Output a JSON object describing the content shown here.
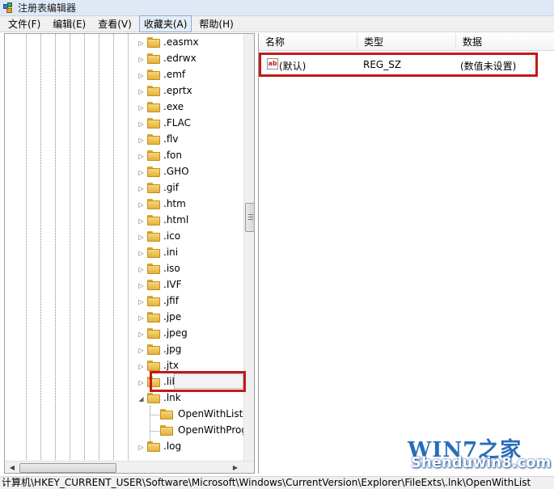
{
  "window": {
    "title": "注册表编辑器"
  },
  "menu": [
    "文件(F)",
    "编辑(E)",
    "查看(V)",
    "收藏夹(A)",
    "帮助(H)"
  ],
  "tree": {
    "items": [
      {
        "label": ".easmx",
        "expander": "▷"
      },
      {
        "label": ".edrwx",
        "expander": "▷"
      },
      {
        "label": ".emf",
        "expander": "▷"
      },
      {
        "label": ".eprtx",
        "expander": "▷"
      },
      {
        "label": ".exe",
        "expander": "▷"
      },
      {
        "label": ".FLAC",
        "expander": "▷"
      },
      {
        "label": ".flv",
        "expander": "▷"
      },
      {
        "label": ".fon",
        "expander": "▷"
      },
      {
        "label": ".GHO",
        "expander": "▷"
      },
      {
        "label": ".gif",
        "expander": "▷"
      },
      {
        "label": ".htm",
        "expander": "▷"
      },
      {
        "label": ".html",
        "expander": "▷"
      },
      {
        "label": ".ico",
        "expander": "▷"
      },
      {
        "label": ".ini",
        "expander": "▷"
      },
      {
        "label": ".iso",
        "expander": "▷"
      },
      {
        "label": ".IVF",
        "expander": "▷"
      },
      {
        "label": ".jfif",
        "expander": "▷"
      },
      {
        "label": ".jpe",
        "expander": "▷"
      },
      {
        "label": ".jpeg",
        "expander": "▷"
      },
      {
        "label": ".jpg",
        "expander": "▷"
      },
      {
        "label": ".jtx",
        "expander": "▷"
      },
      {
        "label": ".library-ms",
        "expander": "▷"
      },
      {
        "label": ".lnk",
        "expander": "◢"
      },
      {
        "label": "OpenWithList",
        "expander": ""
      },
      {
        "label": "OpenWithProgids",
        "expander": ""
      },
      {
        "label": ".log",
        "expander": "▷"
      }
    ]
  },
  "list": {
    "columns": [
      "名称",
      "类型",
      "数据"
    ],
    "rows": [
      {
        "icon": "ab",
        "name": "(默认)",
        "type": "REG_SZ",
        "data": "(数值未设置)"
      }
    ]
  },
  "status": {
    "path": "计算机\\HKEY_CURRENT_USER\\Software\\Microsoft\\Windows\\CurrentVersion\\Explorer\\FileExts\\.lnk\\OpenWithList"
  },
  "watermark": {
    "logo": "WIN7之家",
    "site": "Shenduwin8.com"
  },
  "colors": {
    "highlight_box": "#c21a1a",
    "folder": "#e3b33e",
    "title_bar": "#dfe9f5"
  }
}
